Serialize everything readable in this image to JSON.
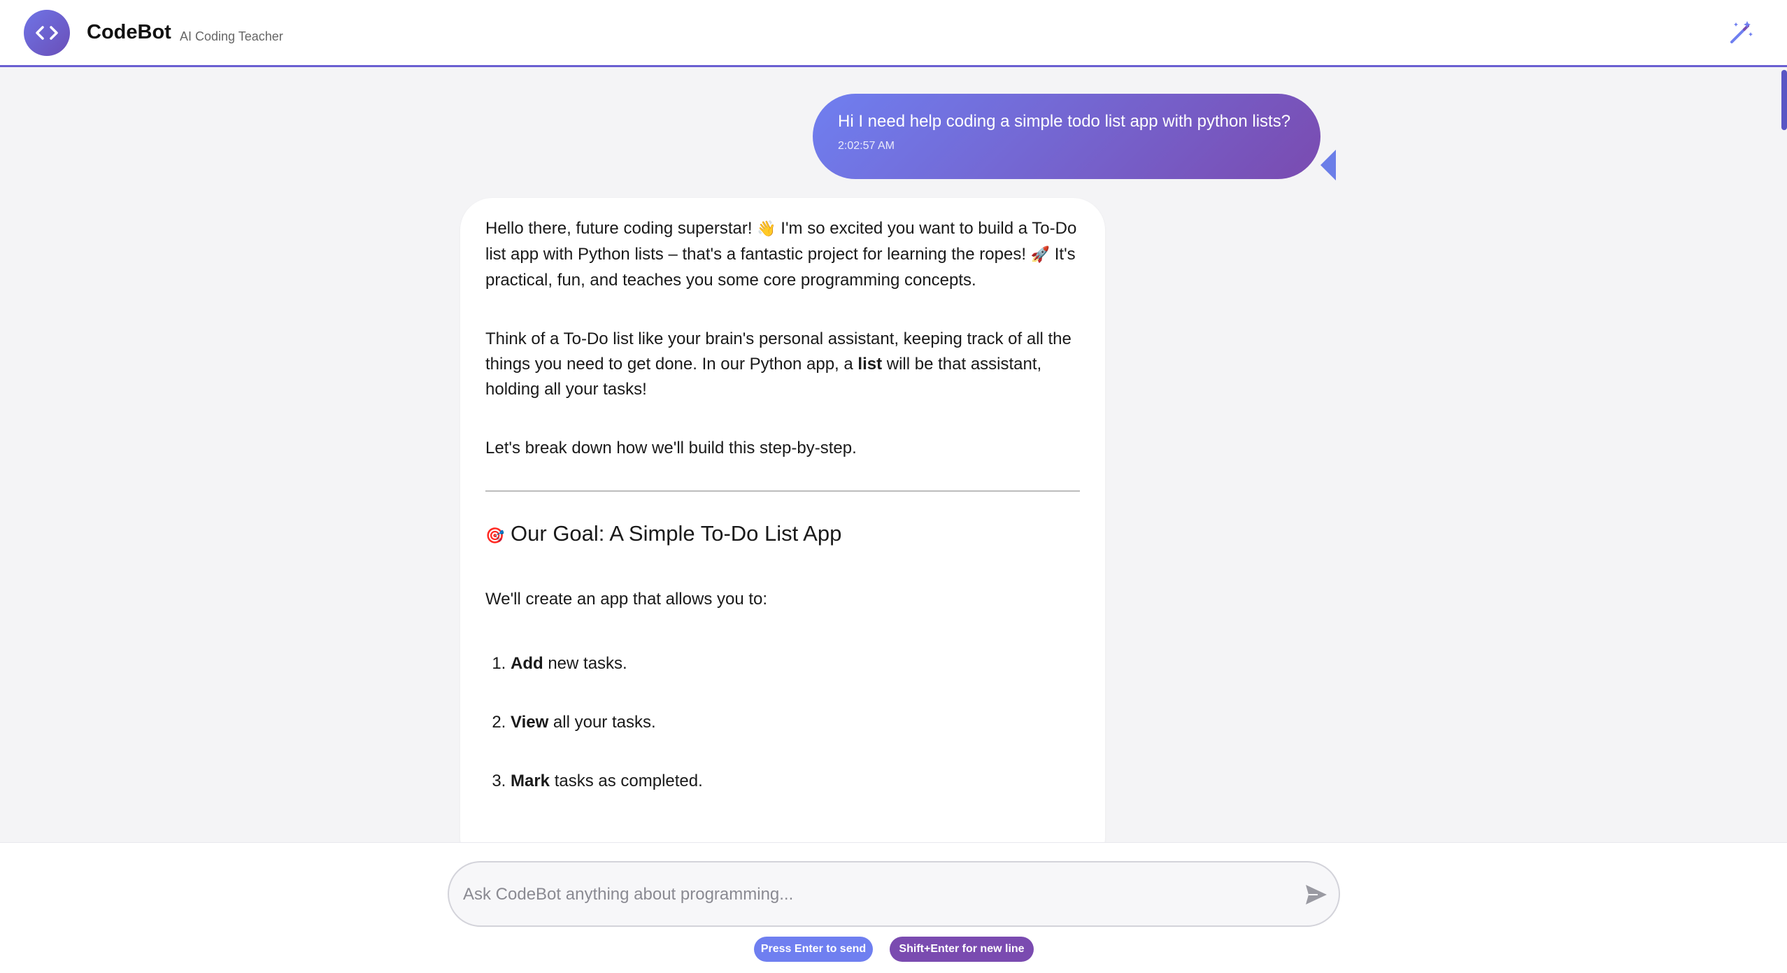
{
  "header": {
    "app_name": "CodeBot",
    "subtitle": "AI Coding Teacher",
    "logo_icon": "code-brackets-icon",
    "action_icon": "magic-wand-icon"
  },
  "colors": {
    "accent_start": "#6f7ff0",
    "accent_end": "#7a4bb0",
    "background": "#f4f4f6"
  },
  "messages": {
    "user": {
      "text": "Hi I need help coding a simple todo list app with python lists?",
      "time": "2:02:57 AM"
    },
    "bot": {
      "intro_a": "Hello there, future coding superstar! ",
      "intro_emoji_wave": "👋",
      "intro_b": " I'm so excited you want to build a To-Do list app with Python lists – that's a fantastic project for learning the ropes! ",
      "intro_emoji_rocket": "🚀",
      "intro_c": " It's practical, fun, and teaches you some core programming concepts.",
      "para2_a": "Think of a To-Do list like your brain's personal assistant, keeping track of all the things you need to get done. In our Python app, a ",
      "para2_bold": "list",
      "para2_b": " will be that assistant, holding all your tasks!",
      "para3": "Let's break down how we'll build this step-by-step.",
      "heading_emoji": "🎯",
      "heading": "Our Goal: A Simple To-Do List App",
      "para4": "We'll create an app that allows you to:",
      "list_items": [
        {
          "bold": "Add",
          "rest": " new tasks."
        },
        {
          "bold": "View",
          "rest": " all your tasks."
        },
        {
          "bold": "Mark",
          "rest": " tasks as completed."
        }
      ]
    }
  },
  "composer": {
    "placeholder": "Ask CodeBot anything about programming...",
    "send_icon": "send-icon",
    "hint_send": "Press Enter to send",
    "hint_newline": "Shift+Enter for new line"
  }
}
